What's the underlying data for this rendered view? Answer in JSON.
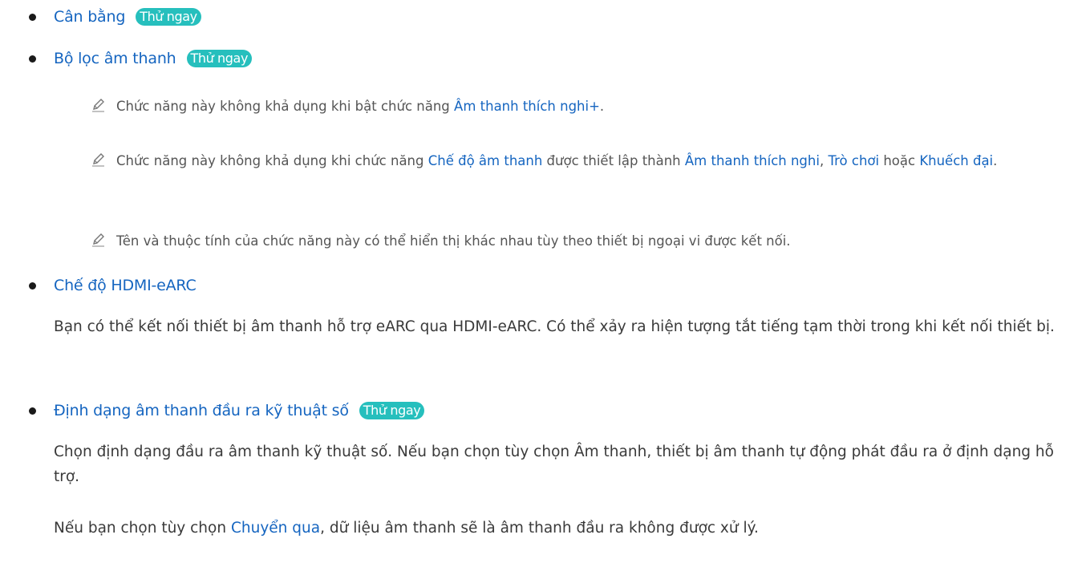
{
  "items": [
    {
      "title": "Cân bằng",
      "try": "Thử ngay"
    },
    {
      "title": "Bộ lọc âm thanh",
      "try": "Thử ngay"
    },
    {
      "title": "Chế độ HDMI-eARC"
    },
    {
      "title": "Định dạng âm thanh đầu ra kỹ thuật số",
      "try": "Thử ngay"
    }
  ],
  "notes": [
    {
      "text1": "Chức năng này không khả dụng khi bật chức năng ",
      "link1": "Âm thanh thích nghi+",
      "text2": "."
    },
    {
      "text1": "Chức năng này không khả dụng khi chức năng ",
      "link1": "Chế độ âm thanh",
      "text2": " được thiết lập thành ",
      "link2": "Âm thanh thích nghi",
      "text3": ", ",
      "link3": "Trò chơi",
      "text4": " hoặc ",
      "link4": "Khuếch đại",
      "text5": "."
    },
    {
      "text1": "Tên và thuộc tính của chức năng này có thể hiển thị khác nhau tùy theo thiết bị ngoại vi được kết nối."
    }
  ],
  "paras": {
    "hdmi": "Bạn có thể kết nối thiết bị âm thanh hỗ trợ eARC qua HDMI-eARC. Có thể xảy ra hiện tượng tắt tiếng tạm thời trong khi kết nối thiết bị.",
    "format": "Chọn định dạng đầu ra âm thanh kỹ thuật số. Nếu bạn chọn tùy chọn Âm thanh, thiết bị âm thanh tự động phát đầu ra ở định dạng hỗ trợ.",
    "passthrough_a": "Nếu bạn chọn tùy chọn ",
    "passthrough_link": "Chuyển qua",
    "passthrough_b": ", dữ liệu âm thanh sẽ là âm thanh đầu ra không được xử lý."
  }
}
